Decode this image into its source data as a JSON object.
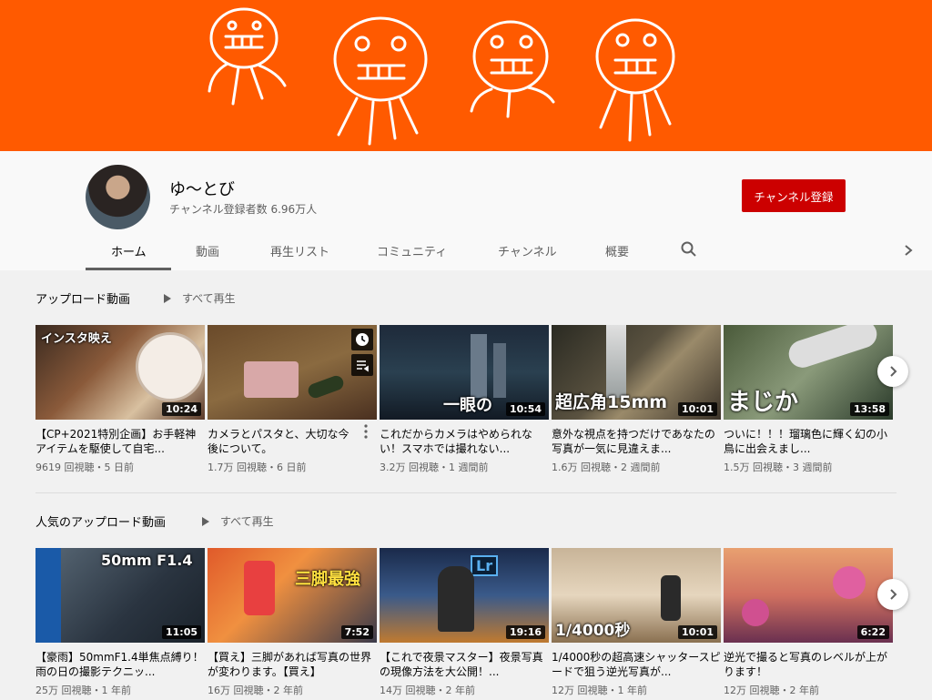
{
  "colors": {
    "banner": "#ff5a00",
    "subscribe": "#cc0000",
    "accent_text": "#606060"
  },
  "channel": {
    "name": "ゆ〜とび",
    "subscribers": "チャンネル登録者数 6.96万人",
    "subscribe_label": "チャンネル登録"
  },
  "tabs": [
    {
      "label": "ホーム",
      "active": true
    },
    {
      "label": "動画"
    },
    {
      "label": "再生リスト"
    },
    {
      "label": "コミュニティ"
    },
    {
      "label": "チャンネル"
    },
    {
      "label": "概要"
    }
  ],
  "icons": {
    "search": "search-icon",
    "next": "chevron-right-icon"
  },
  "sections": [
    {
      "title": "アップロード動画",
      "play_all": "すべて再生",
      "videos": [
        {
          "title": "【CP+2021特別企画】お手軽神アイテムを駆使して自宅...",
          "meta": "9619 回視聴・5 日前",
          "duration": "10:24",
          "overlay": "インスタ映え"
        },
        {
          "title": "カメラとパスタと、大切な今後について。",
          "meta": "1.7万 回視聴・6 日前",
          "duration": "",
          "overlay": ""
        },
        {
          "title": "これだからカメラはやめられない！スマホでは撮れない...",
          "meta": "3.2万 回視聴・1 週間前",
          "duration": "10:54",
          "overlay": "一眼の"
        },
        {
          "title": "意外な視点を持つだけであなたの写真が一気に見違えま...",
          "meta": "1.6万 回視聴・2 週間前",
          "duration": "10:01",
          "overlay": "超広角15mm"
        },
        {
          "title": "ついに！！！瑠璃色に輝く幻の小鳥に出会えまし...",
          "meta": "1.5万 回視聴・3 週間前",
          "duration": "13:58",
          "overlay": "まじか"
        }
      ]
    },
    {
      "title": "人気のアップロード動画",
      "play_all": "すべて再生",
      "videos": [
        {
          "title": "【豪雨】50mmF1.4単焦点縛り！雨の日の撮影テクニッ...",
          "meta": "25万 回視聴・1 年前",
          "duration": "11:05",
          "overlay": "50mm F1.4"
        },
        {
          "title": "【買え】三脚があれば写真の世界が変わります。【買え】",
          "meta": "16万 回視聴・2 年前",
          "duration": "7:52",
          "overlay": "三脚最強"
        },
        {
          "title": "【これで夜景マスター】夜景写真の現像方法を大公開！...",
          "meta": "14万 回視聴・2 年前",
          "duration": "19:16",
          "overlay": "Lr"
        },
        {
          "title": "1/4000秒の超高速シャッタースピードで狙う逆光写真が...",
          "meta": "12万 回視聴・1 年前",
          "duration": "10:01",
          "overlay": "1/4000秒"
        },
        {
          "title": "逆光で撮ると写真のレベルが上がります！",
          "meta": "12万 回視聴・2 年前",
          "duration": "6:22",
          "overlay": ""
        }
      ]
    }
  ]
}
